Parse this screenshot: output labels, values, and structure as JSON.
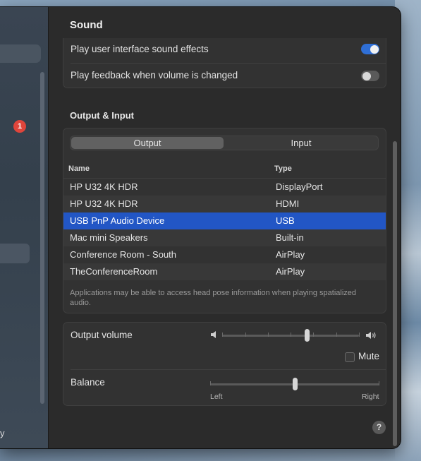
{
  "window": {
    "title": "Sound"
  },
  "sidebar": {
    "badge_count": "1",
    "partial_text": "y"
  },
  "sound_effects": {
    "rows": [
      {
        "label": "Play user interface sound effects",
        "enabled": true
      },
      {
        "label": "Play feedback when volume is changed",
        "enabled": false
      }
    ]
  },
  "output_input": {
    "section_title": "Output & Input",
    "tabs": [
      {
        "label": "Output",
        "selected": true
      },
      {
        "label": "Input",
        "selected": false
      }
    ],
    "columns": [
      "Name",
      "Type"
    ],
    "devices": [
      {
        "name": "HP U32 4K HDR",
        "type": "DisplayPort",
        "selected": false
      },
      {
        "name": "HP U32 4K HDR",
        "type": "HDMI",
        "selected": false
      },
      {
        "name": "USB PnP Audio Device",
        "type": "USB",
        "selected": true
      },
      {
        "name": "Mac mini Speakers",
        "type": "Built-in",
        "selected": false
      },
      {
        "name": "Conference Room - South",
        "type": "AirPlay",
        "selected": false
      },
      {
        "name": "TheConferenceRoom",
        "type": "AirPlay",
        "selected": false
      }
    ],
    "note": "Applications may be able to access head pose information when playing spatialized audio."
  },
  "volume": {
    "label": "Output volume",
    "level": 0.62,
    "mute_label": "Mute",
    "muted": false
  },
  "balance": {
    "label": "Balance",
    "value": 0.5,
    "left_label": "Left",
    "right_label": "Right"
  },
  "help": {
    "symbol": "?"
  },
  "colors": {
    "accent": "#2f6fd6",
    "selection": "#2256c5",
    "badge": "#e0453b"
  }
}
